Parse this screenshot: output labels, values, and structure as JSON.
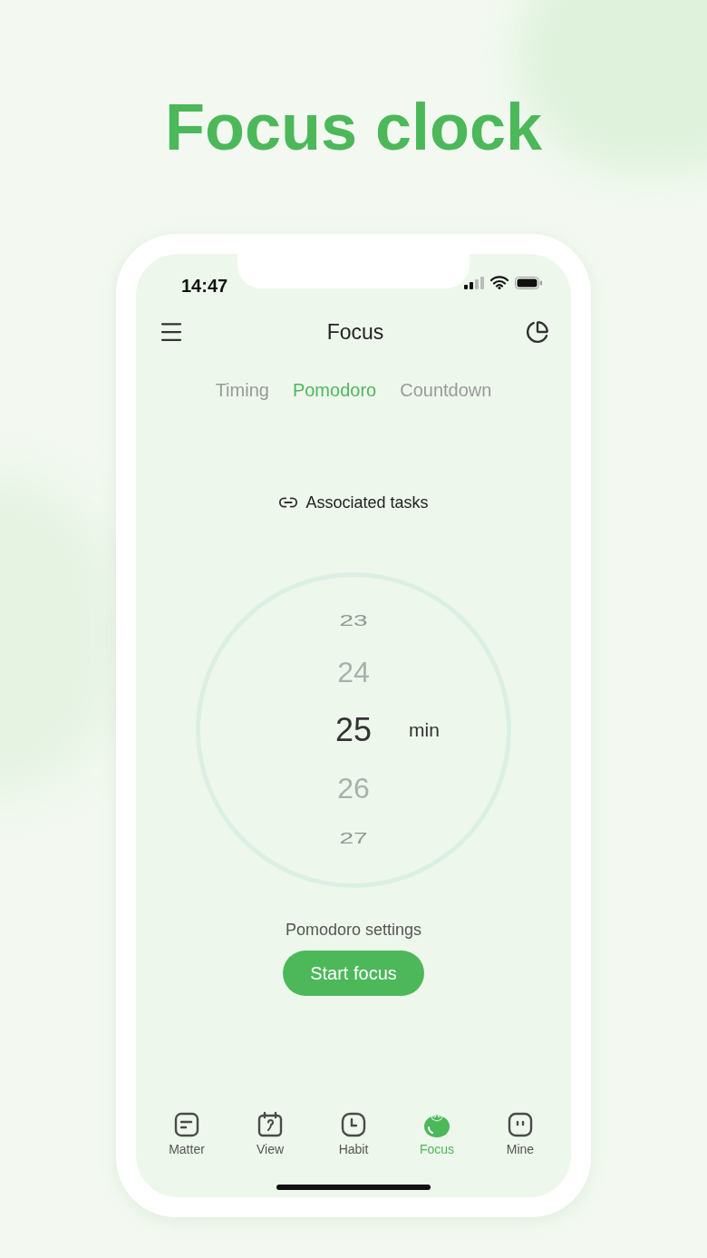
{
  "headline": "Focus clock",
  "status_bar": {
    "time": "14:47"
  },
  "header": {
    "title": "Focus"
  },
  "tabs": [
    {
      "label": "Timing",
      "selected": false
    },
    {
      "label": "Pomodoro",
      "selected": true
    },
    {
      "label": "Countdown",
      "selected": false
    }
  ],
  "associated_tasks": "Associated tasks",
  "picker": {
    "values": [
      {
        "label": "23",
        "selected": false
      },
      {
        "label": "24",
        "selected": false
      },
      {
        "label": "25",
        "selected": true
      },
      {
        "label": "26",
        "selected": false
      },
      {
        "label": "27",
        "selected": false
      }
    ],
    "unit": "min"
  },
  "settings_link": "Pomodoro settings",
  "start_button": "Start focus",
  "nav": [
    {
      "label": "Matter",
      "selected": false
    },
    {
      "label": "View",
      "selected": false
    },
    {
      "label": "Habit",
      "selected": false
    },
    {
      "label": "Focus",
      "selected": true
    },
    {
      "label": "Mine",
      "selected": false
    }
  ]
}
